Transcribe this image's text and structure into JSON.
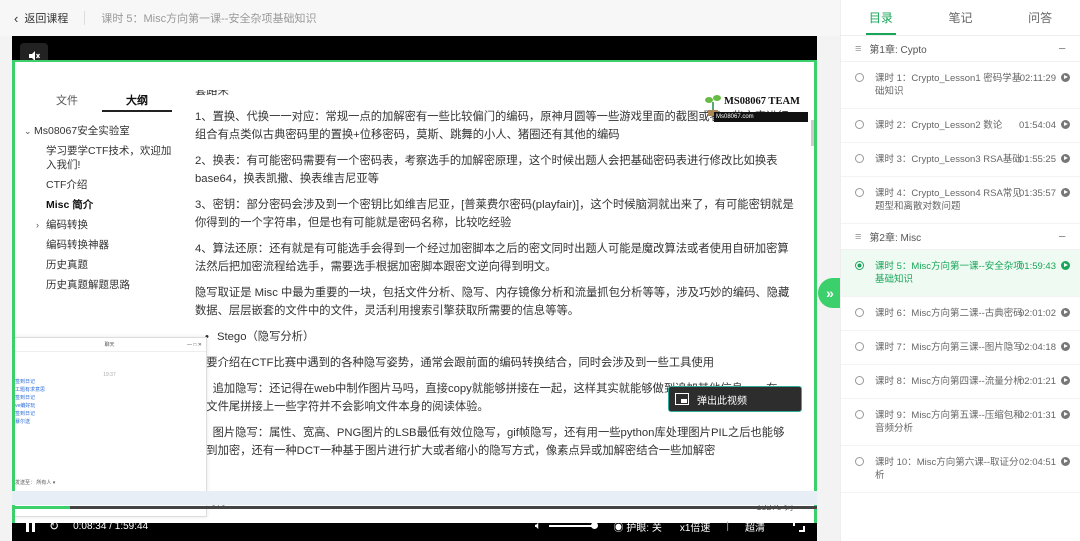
{
  "topbar": {
    "back_label": "返回课程",
    "lesson_title": "课时 5：Misc方向第一课--安全杂项基础知识"
  },
  "player": {
    "watermark": {
      "title": "MS08067 TEAM",
      "subtitle": "Ms08067.com"
    },
    "left_tabs": [
      "文件",
      "大纲"
    ],
    "outline": [
      {
        "label": "Ms08067安全实验室",
        "level": 1,
        "toggle": "v"
      },
      {
        "label": "学习要学CTF技术，欢迎加入我们!",
        "level": 2
      },
      {
        "label": "CTF介绍",
        "level": 2
      },
      {
        "label": "Misc 简介",
        "level": 2,
        "bold": true
      },
      {
        "label": "编码转换",
        "level": 2,
        "toggle": ">"
      },
      {
        "label": "编码转换神器",
        "level": 2
      },
      {
        "label": "历史真题",
        "level": 2
      },
      {
        "label": "历史真题解题思路",
        "level": 2
      }
    ],
    "doc": {
      "p0": "套路来",
      "p1": "1、置换、代换一一对应：常规一点的加解密有一些比较偏门的编码，原神月圆等一些游戏里面的截图或者一些文字进行组合有点类似古典密码里的置换+位移密码，莫斯、跳舞的小人、猪圈还有其他的编码",
      "p2": "2、换表：有可能密码需要有一个密码表，考察选手的加解密原理，这个时候出题人会把基础密码表进行修改比如换表base64，换表凯撒、换表维吉尼亚等",
      "p3": "3、密钥：部分密码会涉及到一个密钥比如维吉尼亚，[普莱费尔密码(playfair)]，这个时候脑洞就出来了，有可能密钥就是你得到的一个字符串，但是也有可能就是密码名称，比较吃经验",
      "p4": "4、算法还原：还有就是有可能选手会得到一个经过加密脚本之后的密文同时出题人可能是魔改算法或者使用自研加密算法然后把加密流程给选手，需要选手根据加密脚本跟密文逆向得到明文。",
      "p5": "隐写取证是 Misc 中最为重要的一块，包括文件分析、隐写、内存镜像分析和流量抓包分析等等，涉及巧妙的编码、隐藏数据、层层嵌套的文件中的文件，灵活利用搜索引擎获取所需要的信息等等。",
      "bullet": "Stego（隐写分析）",
      "p6": "主要介绍在CTF比赛中遇到的各种隐写姿势，通常会跟前面的编码转换结合，同时会涉及到一些工具使用",
      "p7": "0、追加隐写：还记得在web中制作图片马吗，直接copy就能够拼接在一起，这样其实就能够做到追加其他信息，ps在一个文件尾拼接上一些字符并不会影响文件本身的阅读体验。",
      "p8": "1、图片隐写：属性、宽高、PNG图片的LSB最低有效位隐写，gif帧隐写，还有用一些python库处理图片PIL之后也能够做到加密，还有一种DCT一种基于图片进行扩大或者缩小的隐写方式，像素点异或加解密结合一些加解密",
      "word_count": "13276 词",
      "code_label": "</>"
    },
    "popout_label": "弹出此视频",
    "chat": {
      "title": "聊天",
      "time": "19:37",
      "items": [
        "签到日记",
        "工题有求意思",
        "签到日记",
        "ve编好玩",
        "签到日记",
        "暴尔送"
      ],
      "send_to": "发送至： 所有人 ▾"
    },
    "time": "0:08:34 / 1:59:44",
    "progress": 0.0716,
    "eye_label": "护眼: 关",
    "speed_label": "x1倍速",
    "quality_label": "超清"
  },
  "panel": {
    "tabs": [
      "目录",
      "笔记",
      "问答"
    ],
    "chapters": [
      {
        "title": "第1章: Cypto",
        "lessons": [
          {
            "title": "课时 1：Crypto_Lesson1 密码学基础知识",
            "dur": "02:11:29"
          },
          {
            "title": "课时 2：Crypto_Lesson2 数论",
            "dur": "01:54:04"
          },
          {
            "title": "课时 3：Crypto_Lesson3 RSA基础",
            "dur": "01:55:25"
          },
          {
            "title": "课时 4：Crypto_Lesson4 RSA常见题型和离散对数问题",
            "dur": "01:35:57"
          }
        ]
      },
      {
        "title": "第2章: Misc",
        "lessons": [
          {
            "title": "课时 5：Misc方向第一课--安全杂项基础知识",
            "dur": "01:59:43",
            "active": true
          },
          {
            "title": "课时 6：Misc方向第二课--古典密码",
            "dur": "02:01:02"
          },
          {
            "title": "课时 7：Misc方向第三课--图片隐写",
            "dur": "02:04:18"
          },
          {
            "title": "课时 8：Misc方向第四课--流量分析",
            "dur": "02:01:21"
          },
          {
            "title": "课时 9：Misc方向第五课--压缩包和音频分析",
            "dur": "02:01:31"
          },
          {
            "title": "课时 10：Misc方向第六课--取证分析",
            "dur": "02:04:51"
          }
        ]
      }
    ]
  },
  "colors": {
    "accent": "#1aa65a",
    "player_green": "#3bd06b"
  }
}
